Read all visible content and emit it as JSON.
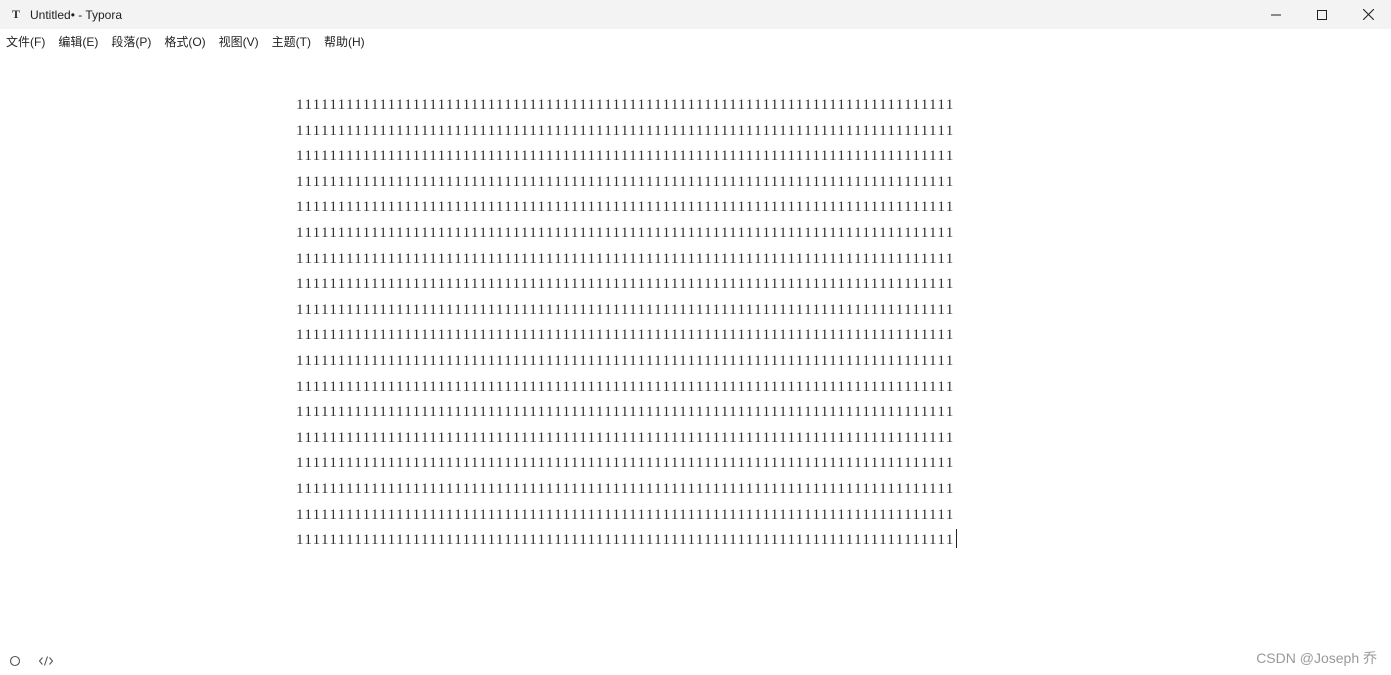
{
  "titlebar": {
    "app_icon_glyph": "T",
    "title": "Untitled• - Typora",
    "controls": [
      "minimize-icon",
      "maximize-icon",
      "close-icon"
    ]
  },
  "menubar": {
    "items": [
      {
        "label": "文件(F)"
      },
      {
        "label": "编辑(E)"
      },
      {
        "label": "段落(P)"
      },
      {
        "label": "格式(O)"
      },
      {
        "label": "视图(V)"
      },
      {
        "label": "主题(T)"
      },
      {
        "label": "帮助(H)"
      }
    ]
  },
  "editor": {
    "lines": [
      "1111111111111111111111111111111111111111111111111111111111111111111111111111111",
      "1111111111111111111111111111111111111111111111111111111111111111111111111111111",
      "1111111111111111111111111111111111111111111111111111111111111111111111111111111",
      "1111111111111111111111111111111111111111111111111111111111111111111111111111111",
      "1111111111111111111111111111111111111111111111111111111111111111111111111111111",
      "1111111111111111111111111111111111111111111111111111111111111111111111111111111",
      "1111111111111111111111111111111111111111111111111111111111111111111111111111111",
      "1111111111111111111111111111111111111111111111111111111111111111111111111111111",
      "1111111111111111111111111111111111111111111111111111111111111111111111111111111",
      "1111111111111111111111111111111111111111111111111111111111111111111111111111111",
      "1111111111111111111111111111111111111111111111111111111111111111111111111111111",
      "1111111111111111111111111111111111111111111111111111111111111111111111111111111",
      "1111111111111111111111111111111111111111111111111111111111111111111111111111111",
      "1111111111111111111111111111111111111111111111111111111111111111111111111111111",
      "1111111111111111111111111111111111111111111111111111111111111111111111111111111",
      "1111111111111111111111111111111111111111111111111111111111111111111111111111111",
      "1111111111111111111111111111111111111111111111111111111111111111111111111111111",
      "1111111111111111111111111111111111111111111111111111111111111111111111111111111"
    ]
  },
  "statusbar": {
    "left_icons": [
      "circle-outline-icon",
      "source-code-icon"
    ]
  },
  "watermark": {
    "text": "CSDN @Joseph 乔"
  }
}
